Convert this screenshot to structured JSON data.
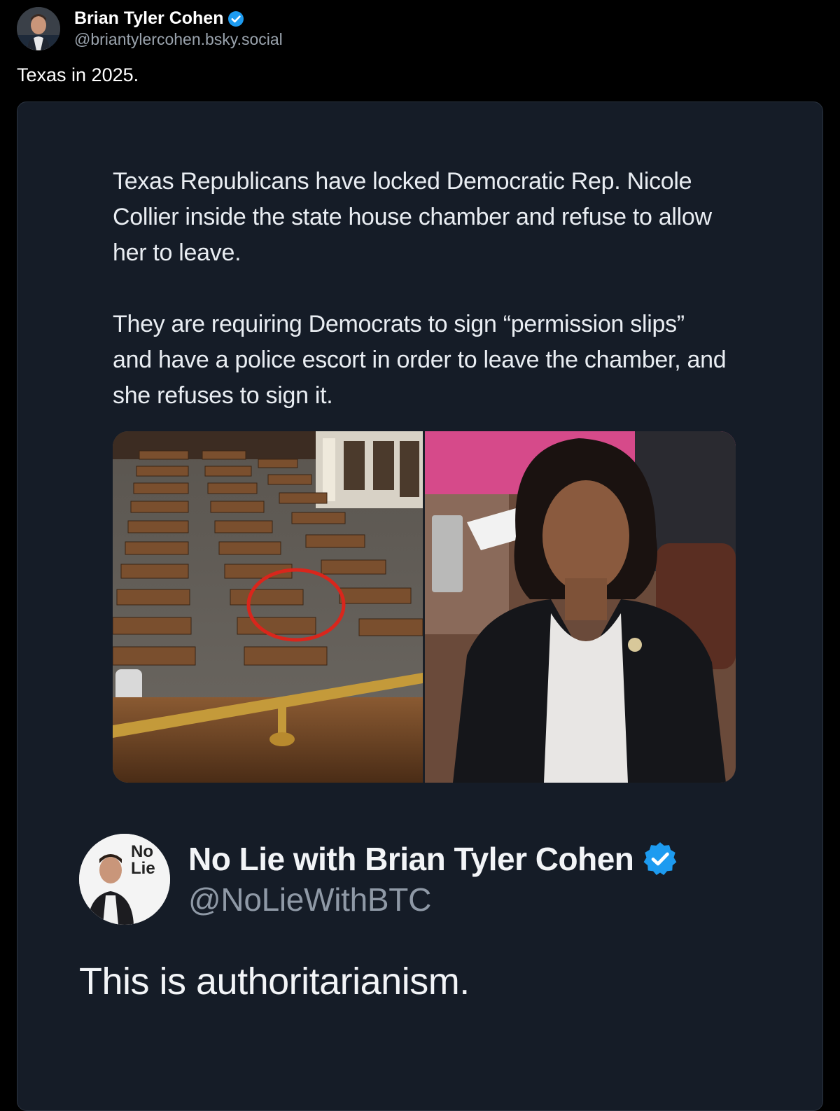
{
  "post": {
    "author_name": "Brian Tyler Cohen",
    "author_handle": "@briantylercohen.bsky.social",
    "text": "Texas in 2025.",
    "verified_icon": "verified-check-icon"
  },
  "embed": {
    "paragraphs": [
      "Texas Republicans have locked Democratic Rep. Nicole Collier inside the state house chamber and refuse to allow her to leave.",
      "They are requiring Democrats to sign “permission slips” and have a police escort in order to leave the chamber, and she refuses to sign it."
    ],
    "photos": {
      "left_icon": "house-chamber-photo",
      "right_icon": "portrait-photo"
    },
    "quote": {
      "author_name": "No Lie with Brian Tyler Cohen",
      "author_handle": "@NoLieWithBTC",
      "text": "This is authoritarianism.",
      "avatar_logo_top": "No",
      "avatar_logo_bottom": "Lie"
    }
  },
  "colors": {
    "background": "#000000",
    "card": "#151c27",
    "verified": "#1d9bf0",
    "circle_highlight": "#d9261c"
  }
}
